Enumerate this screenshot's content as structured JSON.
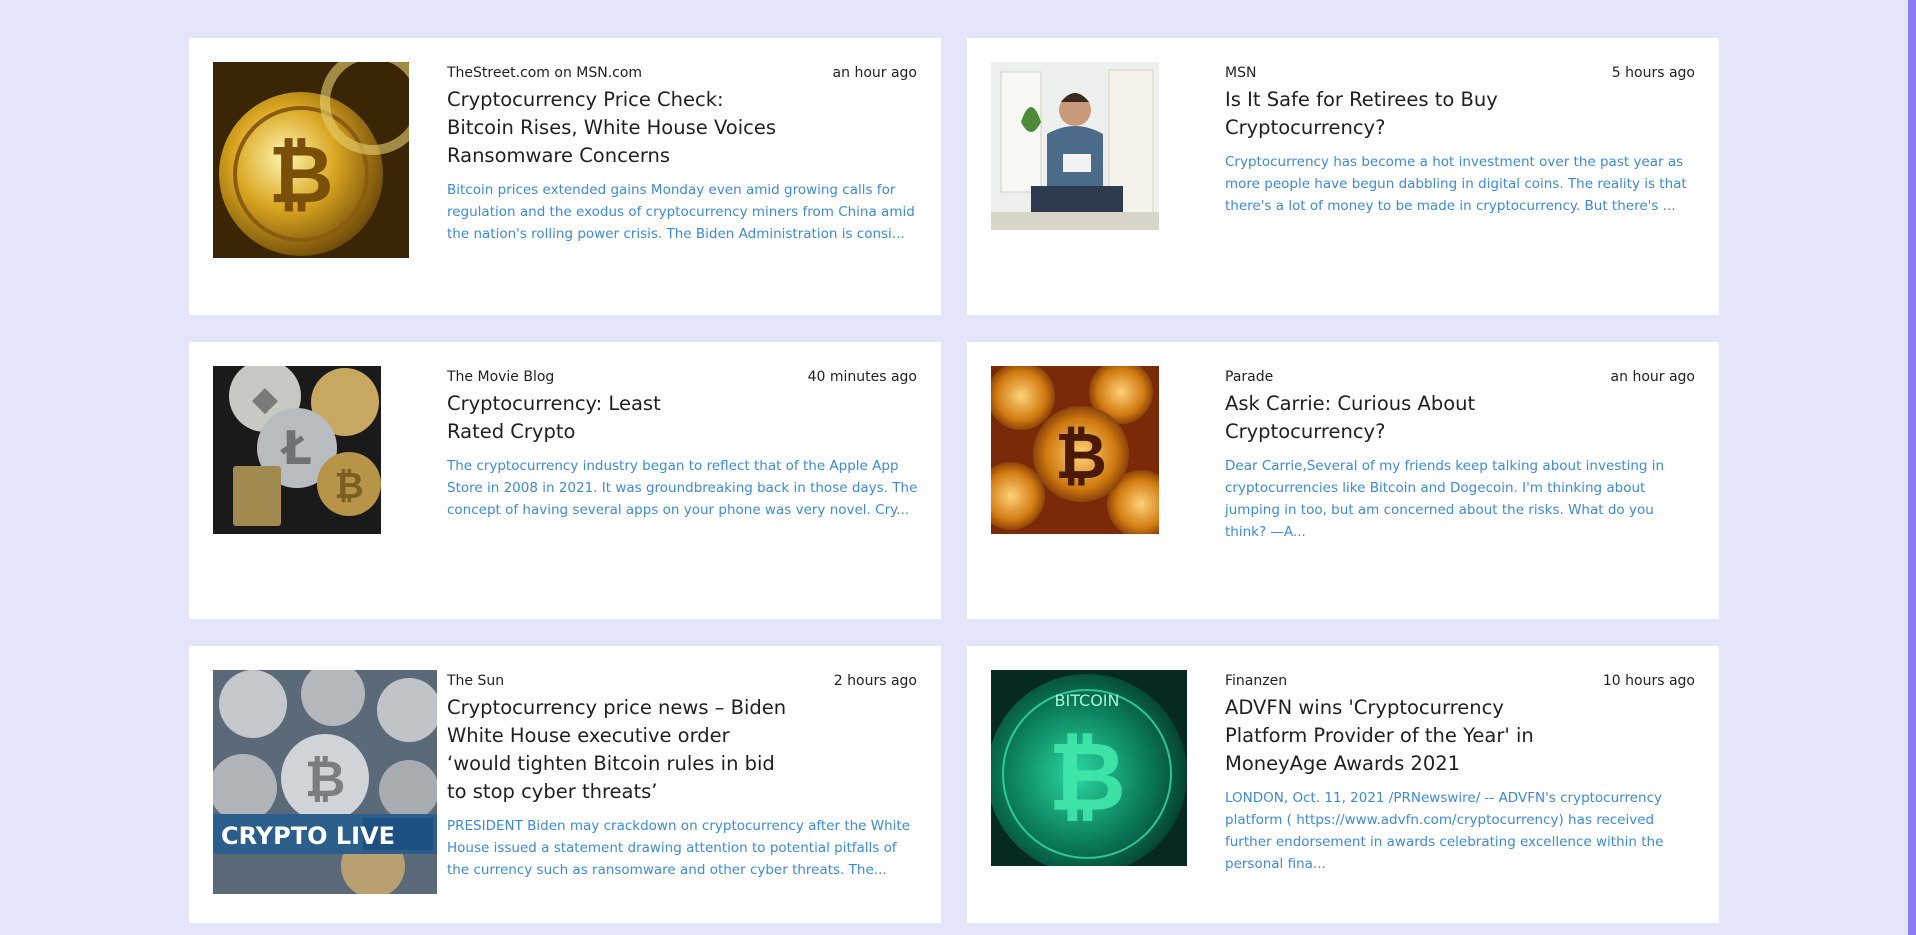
{
  "articles": [
    {
      "source": "TheStreet.com on MSN.com",
      "time": "an hour ago",
      "title": "Cryptocurrency Price Check: Bitcoin Rises, White House Voices Ransomware Concerns",
      "summary": "Bitcoin prices extended gains Monday even amid growing calls for regulation and the exodus of cryptocurrency miners from China amid the nation's rolling power crisis. The Biden Administration is consi..."
    },
    {
      "source": "MSN",
      "time": "5 hours ago",
      "title": "Is It Safe for Retirees to Buy Cryptocurrency?",
      "summary": "Cryptocurrency has become a hot investment over the past year as more people have begun dabbling in digital coins. The reality is that there's a lot of money to be made in cryptocurrency. But there's ..."
    },
    {
      "source": "The Movie Blog",
      "time": "40 minutes ago",
      "title": "Cryptocurrency: Least Rated Crypto",
      "summary": "The cryptocurrency industry began to reflect that of the Apple App Store in 2008 in 2021. It was groundbreaking back in those days. The concept of having several apps on your phone was very novel. Cry..."
    },
    {
      "source": "Parade",
      "time": "an hour ago",
      "title": "Ask Carrie: Curious About Cryptocurrency?",
      "summary": "Dear Carrie,Several of my friends keep talking about investing in cryptocurrencies like Bitcoin and Dogecoin. I'm thinking about jumping in too, but am concerned about the risks. What do you think? —A..."
    },
    {
      "source": "The Sun",
      "time": "2 hours ago",
      "title": "Cryptocurrency price news – Biden White House executive order ‘would tighten Bitcoin rules in bid to stop cyber threats’",
      "summary": "PRESIDENT Biden may crackdown on cryptocurrency after the White House issued a statement drawing attention to potential pitfalls of the currency such as ransomware and other cyber threats. The...",
      "image_text": "CRYPTO LIVE"
    },
    {
      "source": "Finanzen",
      "time": "10 hours ago",
      "title": "ADVFN wins 'Cryptocurrency Platform Provider of the Year' in MoneyAge Awards 2021",
      "summary": "LONDON, Oct. 11, 2021 /PRNewswire/ -- ADVFN's cryptocurrency platform ( https://www.advfn.com/cryptocurrency) has received further endorsement in awards celebrating excellence within the personal fina...",
      "image_text": "BITCOIN"
    }
  ],
  "colors": {
    "page_background": "#e5e5fa",
    "card_background": "#ffffff",
    "summary_text": "#3d8ad6",
    "scrollbar_thumb": "#8c7cf0"
  }
}
